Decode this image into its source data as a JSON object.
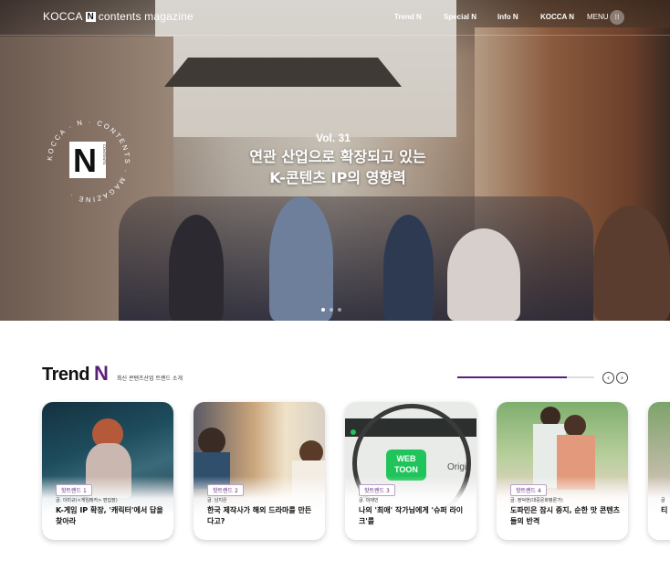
{
  "header": {
    "logo_prefix": "KOCCA",
    "logo_n": "N",
    "logo_suffix": "contents magazine",
    "nav": [
      "Trend N",
      "Special N",
      "Info N",
      "KOCCA N"
    ],
    "menu_label": "MENU",
    "menu_icon": "grid-dots-icon"
  },
  "badge": {
    "ring_text": "KOCCA · N · CONTENTS · MAGAZINE ·",
    "center_letter": "N",
    "center_top": "CONTENTS",
    "center_bottom": "MAGAZINE"
  },
  "hero": {
    "volume": "Vol. 31",
    "headline_line1": "연관 산업으로 확장되고 있는",
    "headline_line2": "K-콘텐츠 IP의 영향력",
    "slide_count": 3,
    "active_slide": 1
  },
  "trend": {
    "title_word": "Trend",
    "title_n": "N",
    "subtitle": "최신 콘텐츠산업 트렌드 소개",
    "progress": 0.8,
    "prev_icon": "chevron-left-icon",
    "next_icon": "chevron-right-icon",
    "cards": [
      {
        "tag": "핫트렌드 1",
        "author": "글. 이미규(<게임메카> 편집장)",
        "title": "K-게임 IP 확장, '캐릭터'에서 답을 찾아라"
      },
      {
        "tag": "핫트렌드 2",
        "author": "글. 남지은",
        "title": "한국 제작사가 해외 드라마를 만든다고?"
      },
      {
        "tag": "핫트렌드 3",
        "author": "글. 이재민",
        "title": "나의 '최애' 작가님에게 '슈퍼 라이크'를"
      },
      {
        "tag": "핫트렌드 4",
        "author": "글. 정덕현(대중문화평론가)",
        "title": "도파민은 잠시 중지, 순한 맛 콘텐츠들의 반격"
      },
      {
        "tag": "",
        "author": "글",
        "title": "티"
      }
    ]
  },
  "colors": {
    "accent": "#5b1f7a",
    "white": "#ffffff"
  }
}
